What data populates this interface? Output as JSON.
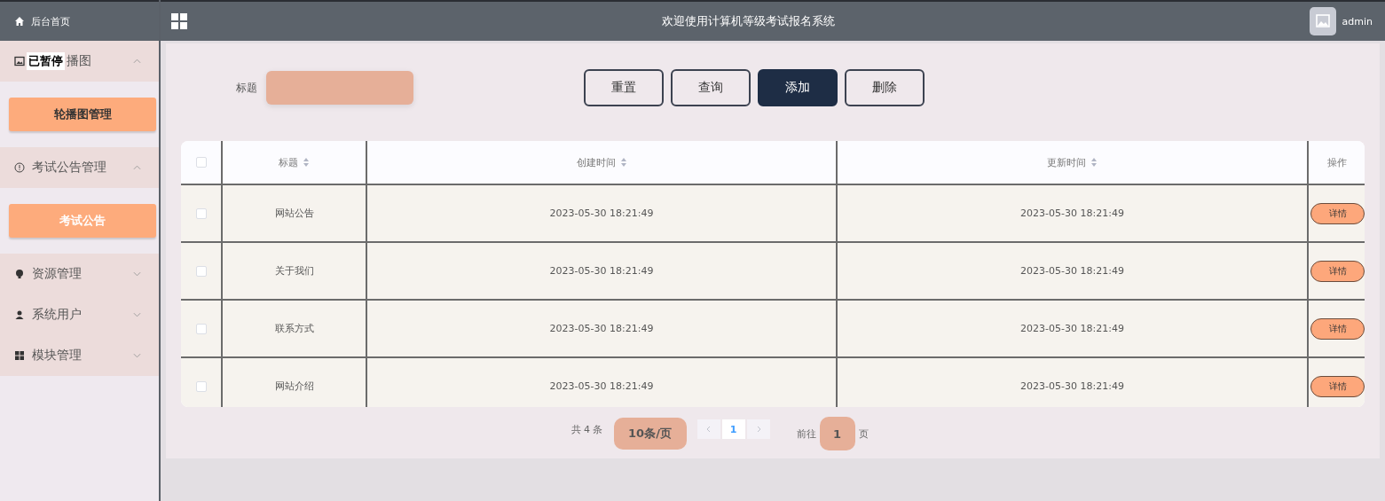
{
  "sidebar": {
    "home": "后台首页",
    "menus": [
      {
        "label": "播图",
        "expanded": true,
        "children": [
          {
            "label": "轮播图管理",
            "selected": true
          }
        ]
      },
      {
        "label": "考试公告管理",
        "expanded": true,
        "children": [
          {
            "label": "考试公告",
            "selected": false
          }
        ]
      },
      {
        "label": "资源管理",
        "expanded": false
      },
      {
        "label": "系统用户",
        "expanded": false
      },
      {
        "label": "模块管理",
        "expanded": false
      }
    ],
    "overlay": "已暂停"
  },
  "header": {
    "title": "欢迎使用计算机等级考试报名系统",
    "user": "admin"
  },
  "search": {
    "label": "标题"
  },
  "buttons": [
    {
      "label": "重置",
      "kind": "outline"
    },
    {
      "label": "查询",
      "kind": "outline"
    },
    {
      "label": "添加",
      "kind": "primary"
    },
    {
      "label": "删除",
      "kind": "outline"
    }
  ],
  "table": {
    "all_checked": false,
    "columns": [
      {
        "label": "标题",
        "sortable": true
      },
      {
        "label": "创建时间",
        "sortable": true
      },
      {
        "label": "更新时间",
        "sortable": true
      },
      {
        "label": "操作",
        "sortable": false
      }
    ],
    "rows": [
      {
        "checked": false,
        "cells": [
          "网站公告",
          "2023-05-30 18:21:49",
          "2023-05-30 18:21:49"
        ],
        "action": "详情"
      },
      {
        "checked": false,
        "cells": [
          "关于我们",
          "2023-05-30 18:21:49",
          "2023-05-30 18:21:49"
        ],
        "action": "详情"
      },
      {
        "checked": false,
        "cells": [
          "联系方式",
          "2023-05-30 18:21:49",
          "2023-05-30 18:21:49"
        ],
        "action": "详情"
      },
      {
        "checked": false,
        "cells": [
          "网站介绍",
          "2023-05-30 18:21:49",
          "2023-05-30 18:21:49"
        ],
        "action": "详情"
      }
    ]
  },
  "pagination": {
    "total": "共 4 条",
    "page_size": "10条/页",
    "pages": [
      {
        "label": "1",
        "selected": true
      }
    ],
    "goto_label": "前往",
    "goto_value": "1",
    "goto_suffix": "页"
  }
}
